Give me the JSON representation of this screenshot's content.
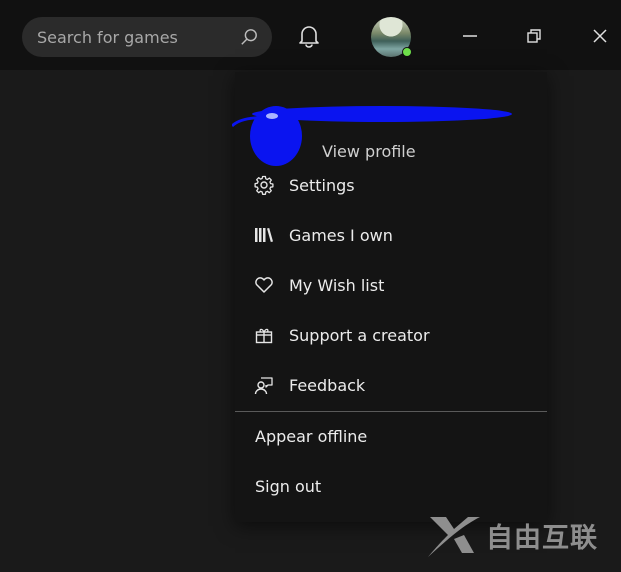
{
  "titlebar": {
    "search": {
      "placeholder": "Search for games",
      "value": "",
      "icon": "search-icon"
    },
    "notifications": {
      "icon": "bell-icon"
    },
    "avatar": {
      "status": "online",
      "status_color": "#6fe04b"
    },
    "window_controls": {
      "minimize": {
        "icon": "minimize-icon"
      },
      "restore": {
        "icon": "restore-icon"
      },
      "close": {
        "icon": "close-icon"
      }
    }
  },
  "menu": {
    "profile": {
      "view_profile_label": "View profile",
      "redacted": true,
      "redaction_color": "#0000ff"
    },
    "items": [
      {
        "label": "Settings",
        "icon": "gear-icon"
      },
      {
        "label": "Games I own",
        "icon": "library-icon"
      },
      {
        "label": "My Wish list",
        "icon": "heart-icon"
      },
      {
        "label": "Support a creator",
        "icon": "gift-icon"
      },
      {
        "label": "Feedback",
        "icon": "feedback-icon"
      }
    ],
    "secondary_items": [
      {
        "label": "Appear offline"
      },
      {
        "label": "Sign out"
      }
    ]
  },
  "watermark": {
    "text": "自由互联"
  }
}
